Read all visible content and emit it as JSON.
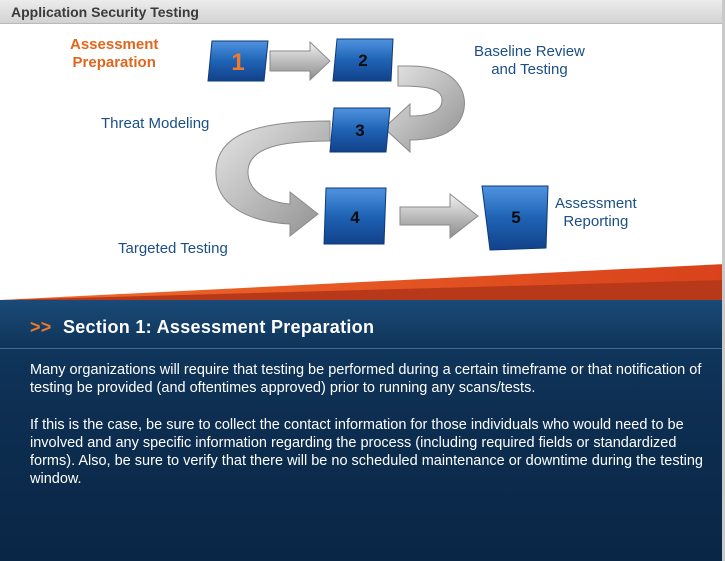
{
  "window": {
    "title": "Application Security Testing"
  },
  "diagram": {
    "steps": [
      {
        "number": "1",
        "label": "Assessment Preparation",
        "label_lines": [
          "Assessment",
          "Preparation"
        ],
        "active": true
      },
      {
        "number": "2",
        "label": "Baseline Review and Testing",
        "label_lines": [
          "Baseline Review",
          "and Testing"
        ],
        "active": false
      },
      {
        "number": "3",
        "label": "Threat Modeling",
        "label_lines": [
          "Threat Modeling"
        ],
        "active": false
      },
      {
        "number": "4",
        "label": "Targeted Testing",
        "label_lines": [
          "Targeted Testing"
        ],
        "active": false
      },
      {
        "number": "5",
        "label": "Assessment Reporting",
        "label_lines": [
          "Assessment",
          "Reporting"
        ],
        "active": false
      }
    ],
    "colors": {
      "box": "#1f63b5",
      "active_number": "#f07a28",
      "arrow": "#a9a9a9",
      "accent": "#e0661d"
    }
  },
  "section": {
    "prefix": ">>",
    "title": "Section 1:  Assessment Preparation",
    "paragraphs": [
      "Many organizations will require that testing be performed during a certain timeframe or that notification of testing be provided (and oftentimes approved) prior to running any scans/tests.",
      "If this is the case, be sure to collect the contact information for those individuals who would need to be involved and any specific information regarding the process (including required fields or standardized forms). Also, be sure to verify that there will be no scheduled maintenance or downtime during the testing window."
    ]
  }
}
